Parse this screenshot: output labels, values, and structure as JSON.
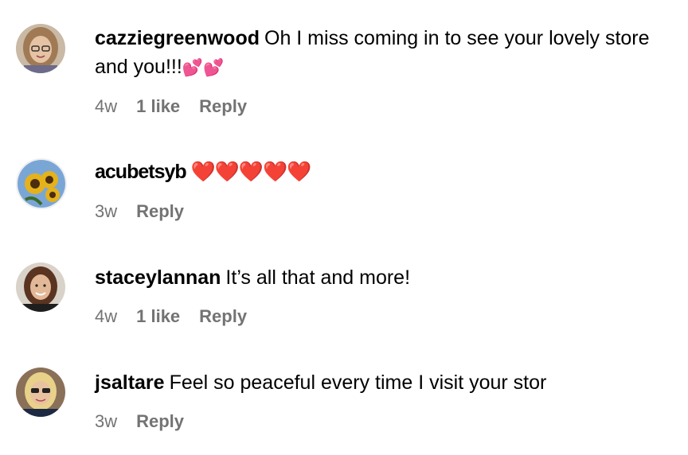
{
  "comments": [
    {
      "username": "cazziegreenwood",
      "text": "Oh I miss coming in to see your lovely store and you!!!",
      "emoji": "💕💕",
      "time": "4w",
      "likes": "1 like",
      "reply": "Reply"
    },
    {
      "username": "acubetsyb",
      "text": "",
      "emoji": "❤️❤️❤️❤️❤️",
      "time": "3w",
      "likes": "",
      "reply": "Reply"
    },
    {
      "username": "staceylannan",
      "text": "It’s all that and more!",
      "emoji": "",
      "time": "4w",
      "likes": "1 like",
      "reply": "Reply"
    },
    {
      "username": "jsaltare",
      "text": "Feel so peaceful every time I visit your stor",
      "emoji": "",
      "time": "3w",
      "likes": "",
      "reply": "Reply"
    }
  ],
  "icons": {
    "avatar_1": "avatar-woman-glasses-icon",
    "avatar_2": "avatar-sunflowers-icon",
    "avatar_3": "avatar-woman-brown-hair-icon",
    "avatar_4": "avatar-woman-blonde-sunglasses-icon"
  },
  "colors": {
    "meta_text": "#737373",
    "heart_red": "#e0245e",
    "heart_pink": "#f25cb5"
  }
}
